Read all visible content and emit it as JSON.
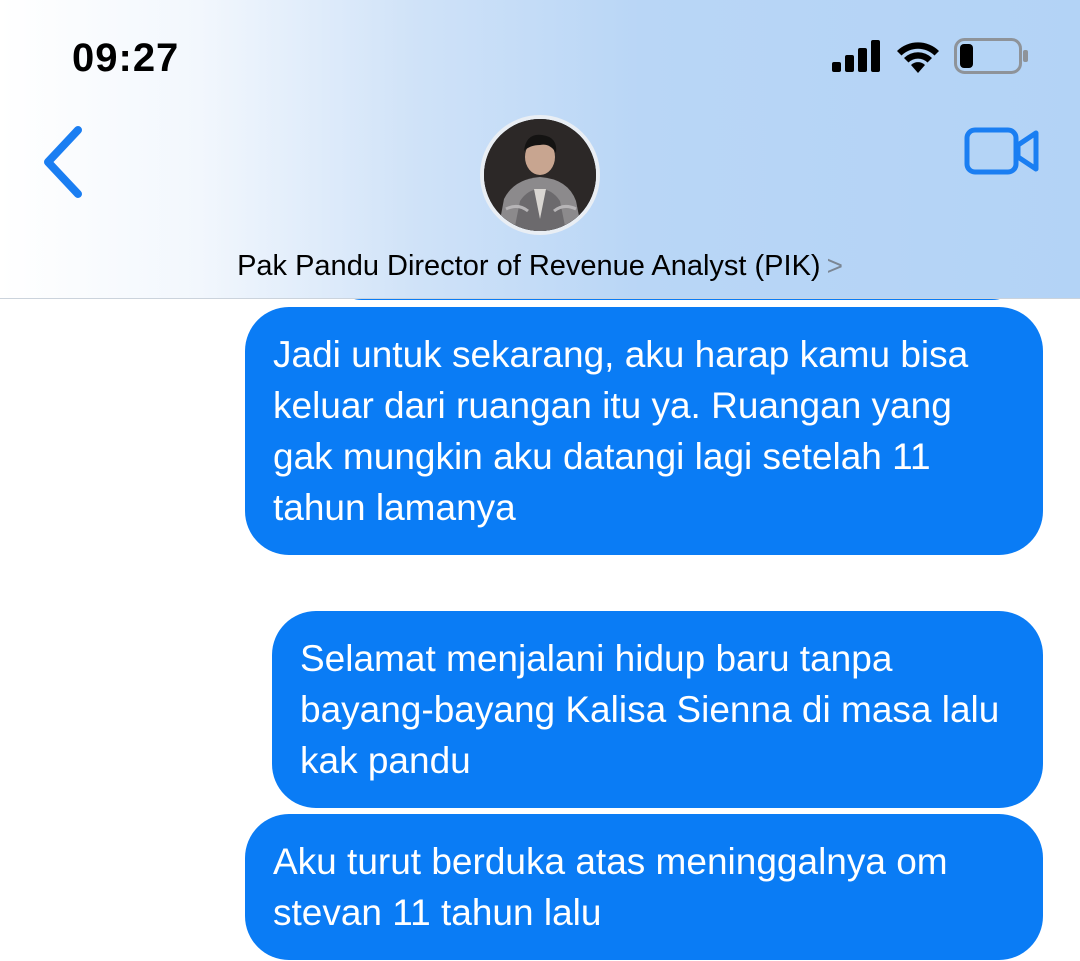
{
  "status_bar": {
    "time": "09:27",
    "icons": [
      "signal-icon",
      "wifi-icon",
      "battery-icon"
    ],
    "battery_level": 0.2
  },
  "header": {
    "back_icon": "chevron-left-icon",
    "video_icon": "video-camera-icon",
    "contact_name": "Pak Pandu Director of Revenue Analyst (PIK)",
    "chevron": ">"
  },
  "messages": [
    {
      "text": "Jadi untuk sekarang, aku harap kamu bisa keluar dari ruangan itu ya. Ruangan yang gak mungkin aku datangi lagi setelah 11 tahun lamanya",
      "sender": "me"
    },
    {
      "text": "Selamat menjalani hidup baru tanpa bayang-bayang Kalisa Sienna di masa lalu kak pandu",
      "sender": "me"
    },
    {
      "text": "Aku turut berduka atas meninggalnya om stevan 11 tahun lalu",
      "sender": "me"
    }
  ],
  "colors": {
    "bubble": "#0a7cf5",
    "accent": "#1a7ef2",
    "header_tint": "#b3d3f6"
  }
}
